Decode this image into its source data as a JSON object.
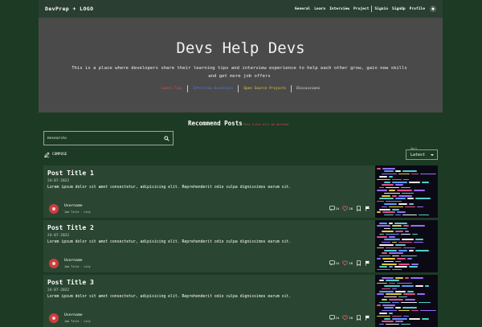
{
  "header": {
    "logo": "DevPrep + LOGO",
    "nav": [
      "General",
      "Learn",
      "Interview",
      "Project",
      "Signin",
      "SignUp",
      "Profile"
    ]
  },
  "hero": {
    "title": "Devs Help Devs",
    "description": "This is a place where developers share their learning tips and interview experience to help each other grow, gain new skills and get more job offers",
    "links": [
      "Learn Tips",
      "Interview Questions",
      "Open Source Projects",
      "Discussions"
    ]
  },
  "recommend": {
    "title": "Recommend Posts",
    "note": "This title will be deleted"
  },
  "search": {
    "placeholder": "Research>"
  },
  "compose_label": "COMPOSE",
  "sort": {
    "label": "Sort",
    "value": "Latest"
  },
  "posts": [
    {
      "title": "Post Title 1",
      "date": "24-07-2022",
      "excerpt": "Lorem ipsum dolor sit amet consectetur, adipisicing elit. Reprehenderit odio culpa dignissimos earum sit.",
      "username": "Username",
      "job": "Job Title · city",
      "comments": "24",
      "likes": "28"
    },
    {
      "title": "Post Title 2",
      "date": "24-07-2022",
      "excerpt": "Lorem ipsum dolor sit amet consectetur, adipisicing elit. Reprehenderit odio culpa dignissimos earum sit.",
      "username": "Username",
      "job": "Job Title · city",
      "comments": "24",
      "likes": "28"
    },
    {
      "title": "Post Title 3",
      "date": "24-07-2022",
      "excerpt": "Lorem ipsum dolor sit amet consectetur, adipisicing elit. Reprehenderit odio culpa dignissimos earum sit.",
      "username": "Username",
      "job": "Job Title · city",
      "comments": "24",
      "likes": "28"
    }
  ],
  "colors": {
    "page_bg": "#1d3a25",
    "hero_bg": "#4a4a4a",
    "card_bg": "#2a4632",
    "avatar": "#cf3d3d"
  },
  "icons": {
    "theme": "sun-icon",
    "search": "search-icon",
    "compose": "pencil-icon",
    "comment": "comment-icon",
    "like": "heart-icon",
    "save": "bookmark-icon",
    "report": "flag-icon"
  }
}
